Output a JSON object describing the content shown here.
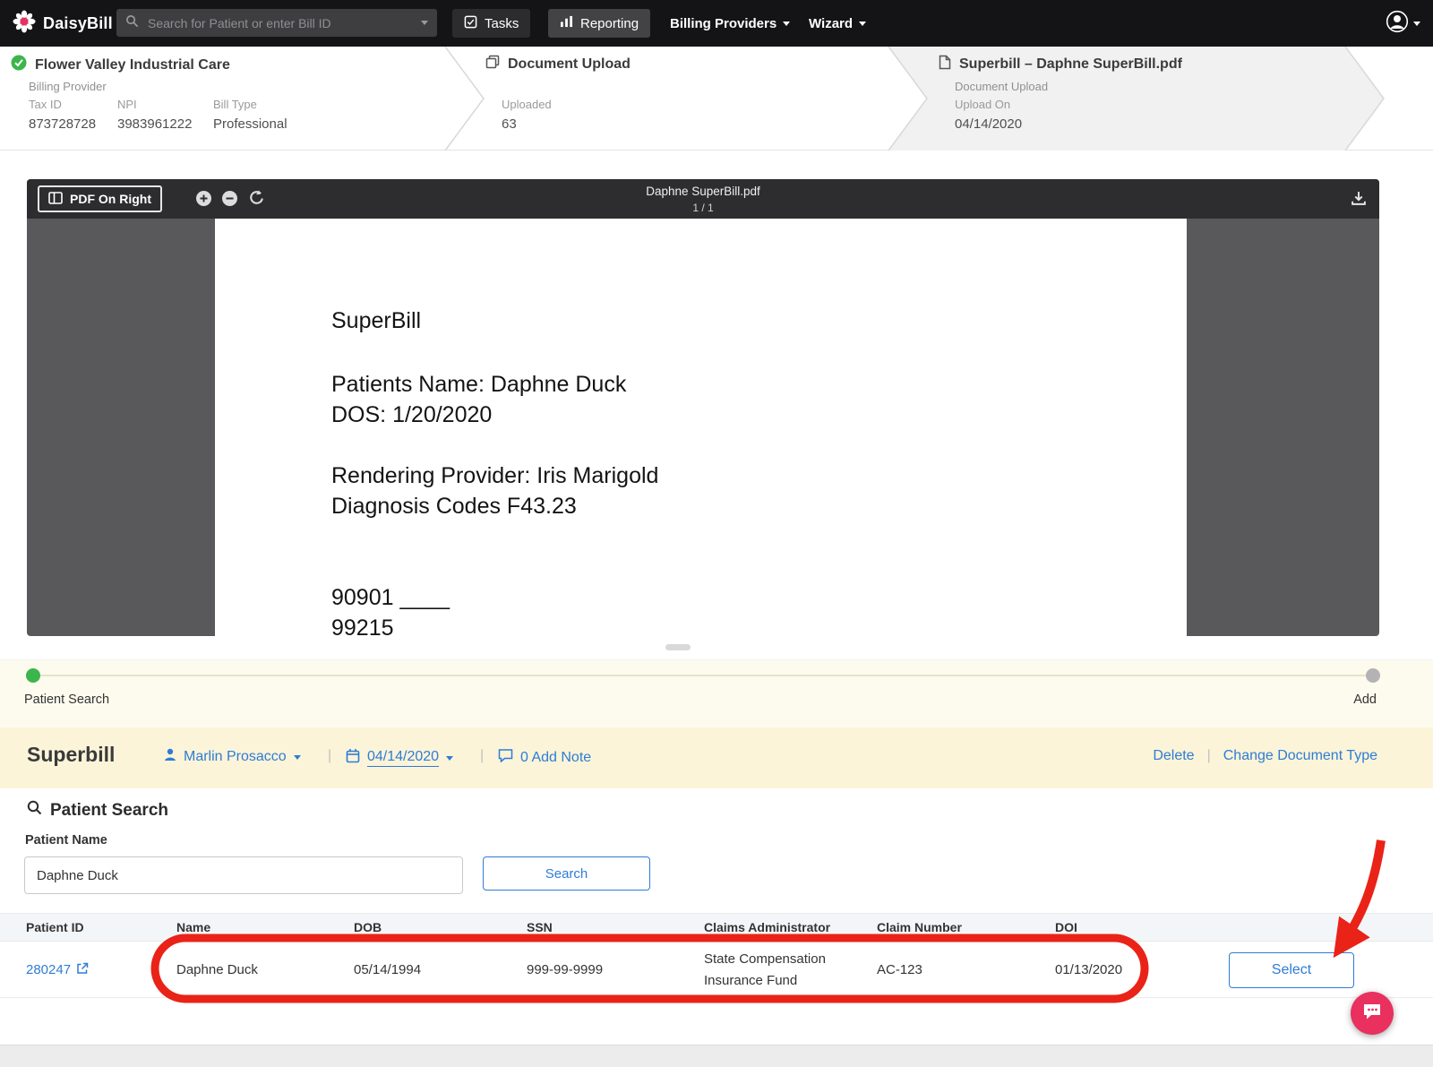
{
  "nav": {
    "brand": "DaisyBill",
    "search_placeholder": "Search for Patient or enter Bill ID",
    "tasks_label": "Tasks",
    "reporting_label": "Reporting",
    "billing_providers_label": "Billing Providers",
    "wizard_label": "Wizard"
  },
  "breadcrumbs": {
    "provider": {
      "title": "Flower Valley Industrial Care",
      "subtitle": "Billing Provider",
      "tax_id_label": "Tax ID",
      "tax_id": "873728728",
      "npi_label": "NPI",
      "npi": "3983961222",
      "bill_type_label": "Bill Type",
      "bill_type": "Professional"
    },
    "document_upload": {
      "title": "Document Upload",
      "uploaded_label": "Uploaded",
      "uploaded": "63"
    },
    "superbill": {
      "title": "Superbill – Daphne SuperBill.pdf",
      "subtitle": "Document Upload",
      "upload_on_label": "Upload On",
      "upload_on": "04/14/2020"
    }
  },
  "pdf_viewer": {
    "pdf_on_right": "PDF On Right",
    "title": "Daphne SuperBill.pdf",
    "page_indicator": "1 / 1",
    "doc": {
      "heading": "SuperBill",
      "patient_line": "Patients Name: Daphne Duck",
      "dos_line": "DOS: 1/20/2020",
      "provider_line": "Rendering Provider: Iris Marigold",
      "diagnosis_line": "Diagnosis Codes F43.23",
      "code_line_1": "90901 ____",
      "code_line_2": "99215"
    }
  },
  "stepper": {
    "left_label": "Patient Search",
    "right_label": "Add"
  },
  "superbill_bar": {
    "title": "Superbill",
    "assignee": "Marlin Prosacco",
    "date": "04/14/2020",
    "note": "0 Add Note",
    "delete_label": "Delete",
    "separator": "|",
    "change_type_label": "Change Document Type"
  },
  "patient_search": {
    "heading": "Patient Search",
    "name_label": "Patient Name",
    "name_value": "Daphne Duck",
    "search_label": "Search"
  },
  "results_table": {
    "columns": [
      "Patient ID",
      "Name",
      "DOB",
      "SSN",
      "Claims Administrator",
      "Claim Number",
      "DOI"
    ],
    "row": {
      "patient_id": "280247",
      "name": "Daphne Duck",
      "dob": "05/14/1994",
      "ssn": "999-99-9999",
      "claims_administrator": "State Compensation Insurance Fund",
      "claim_number": "AC-123",
      "doi": "01/13/2020",
      "select_label": "Select"
    }
  },
  "colors": {
    "accent_blue": "#2e7cd6",
    "annotation_red": "#ea2318",
    "success_green": "#3cb54c",
    "brand_pink": "#e9305e",
    "header_yellow": "#fbf4d8"
  }
}
